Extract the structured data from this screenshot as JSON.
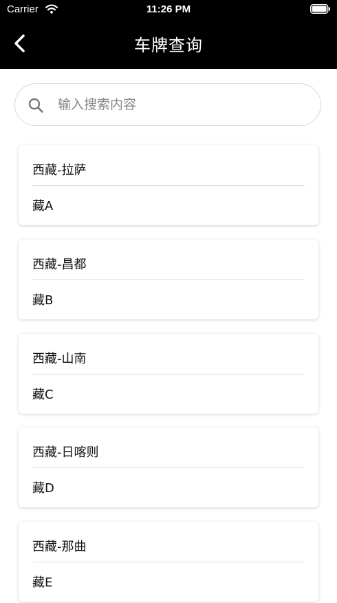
{
  "status_bar": {
    "carrier": "Carrier",
    "time": "11:26 PM"
  },
  "nav": {
    "title": "车牌查询",
    "back_icon": "chevron-left-icon"
  },
  "search": {
    "placeholder": "输入搜索内容",
    "value": "",
    "icon": "search-icon"
  },
  "plates": [
    {
      "region": "西藏-拉萨",
      "code": "藏A"
    },
    {
      "region": "西藏-昌都",
      "code": "藏B"
    },
    {
      "region": "西藏-山南",
      "code": "藏C"
    },
    {
      "region": "西藏-日喀则",
      "code": "藏D"
    },
    {
      "region": "西藏-那曲",
      "code": "藏E"
    }
  ],
  "colors": {
    "header_bg": "#000000",
    "header_text": "#ffffff",
    "page_bg": "#ffffff",
    "divider": "#dddddd"
  }
}
